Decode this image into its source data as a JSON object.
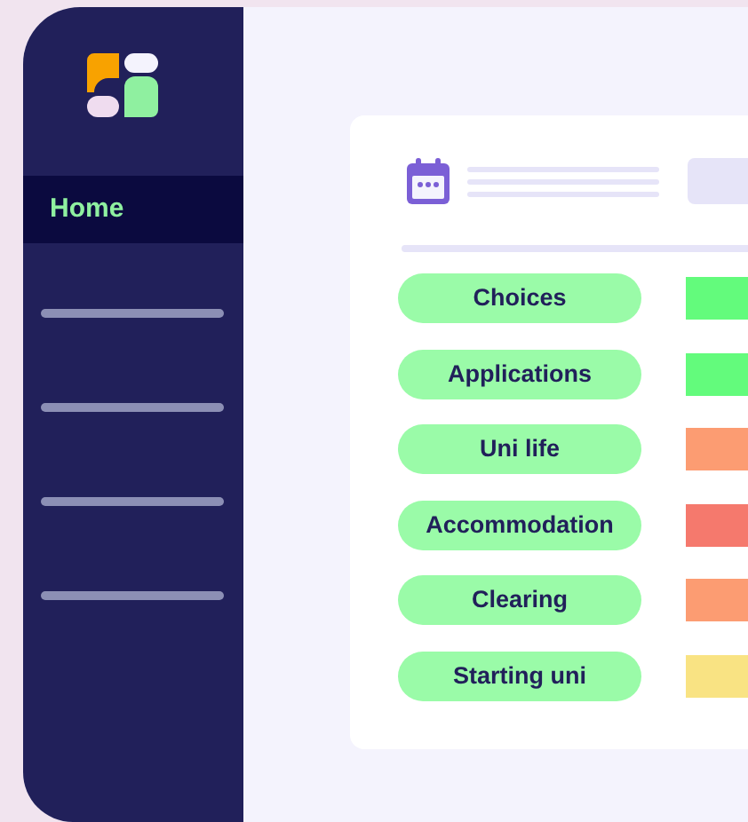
{
  "sidebar": {
    "items": [
      {
        "label": "Home",
        "selected": true
      }
    ]
  },
  "rows": [
    {
      "label": "Choices",
      "color": "#63fb7c"
    },
    {
      "label": "Applications",
      "color": "#63fb7c"
    },
    {
      "label": "Uni life",
      "color": "#fc9c72"
    },
    {
      "label": "Accommodation",
      "color": "#f5796d"
    },
    {
      "label": "Clearing",
      "color": "#fc9c72"
    },
    {
      "label": "Starting uni",
      "color": "#f9e383"
    }
  ]
}
